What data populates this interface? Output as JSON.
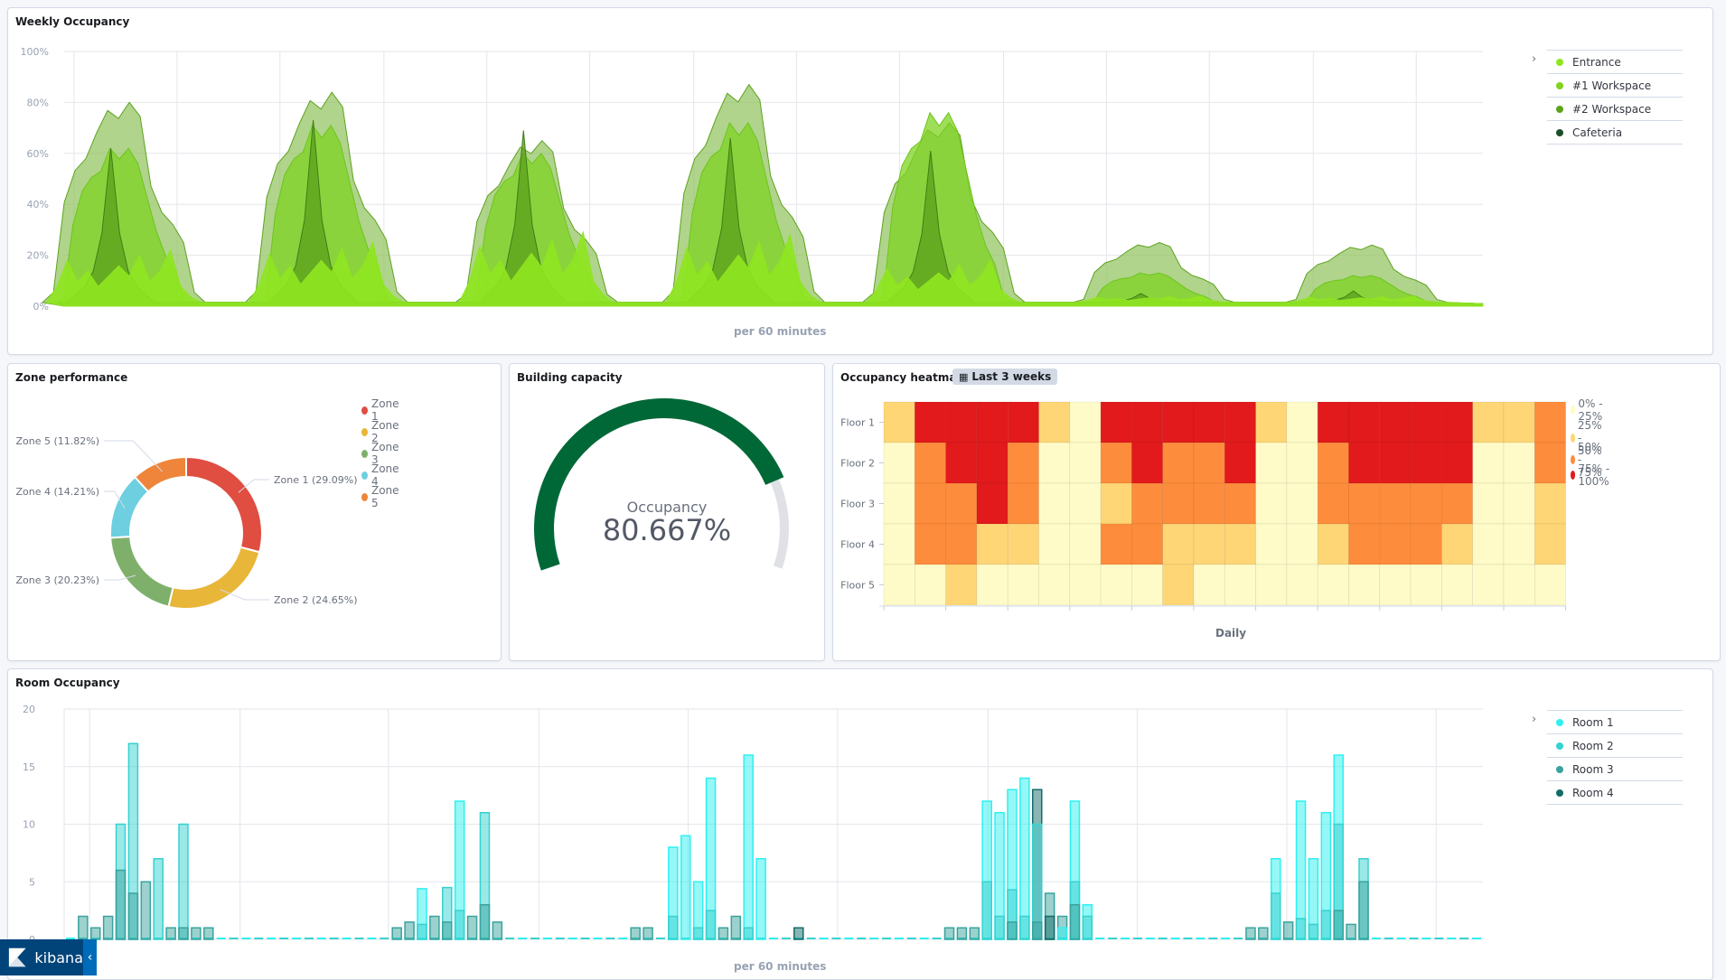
{
  "weekly": {
    "title": "Weekly Occupancy",
    "x_label": "per 60 minutes",
    "y_ticks": [
      "0%",
      "20%",
      "40%",
      "60%",
      "80%",
      "100%"
    ],
    "legend": [
      {
        "label": "Entrance",
        "color": "#8fe520"
      },
      {
        "label": "#1 Workspace",
        "color": "#7fd321"
      },
      {
        "label": "#2 Workspace",
        "color": "#5da31d"
      },
      {
        "label": "Cafeteria",
        "color": "#1e4d2b"
      }
    ]
  },
  "zone": {
    "title": "Zone performance",
    "legend": [
      {
        "label": "Zone 1",
        "color": "#e04d41"
      },
      {
        "label": "Zone 2",
        "color": "#e8b638"
      },
      {
        "label": "Zone 3",
        "color": "#7eb06c"
      },
      {
        "label": "Zone 4",
        "color": "#6dcfe0"
      },
      {
        "label": "Zone 5",
        "color": "#ee853b"
      }
    ]
  },
  "capacity": {
    "title": "Building capacity",
    "label": "Occupancy",
    "value_text": "80.667%",
    "value": 80.667,
    "color": "#006837",
    "track_color": "#e0e1e6"
  },
  "heatmap": {
    "title": "Occupancy heatmap",
    "time_badge": "Last 3 weeks",
    "x_label": "Daily"
  },
  "rooms": {
    "title": "Room Occupancy",
    "x_label": "per 60 minutes",
    "y_ticks": [
      "0",
      "5",
      "10",
      "15",
      "20"
    ],
    "legend": [
      {
        "label": "Room 1",
        "color": "#2ef0f0"
      },
      {
        "label": "Room 2",
        "color": "#36d2d0"
      },
      {
        "label": "Room 3",
        "color": "#3aa39e"
      },
      {
        "label": "Room 4",
        "color": "#146b69"
      }
    ]
  },
  "brand": {
    "name": "kibana",
    "collapse_icon": "‹"
  },
  "chart_data": [
    {
      "type": "area",
      "title": "Weekly Occupancy",
      "xlabel": "per 60 minutes",
      "ylabel": "",
      "ylim": [
        0,
        100
      ],
      "grid": true,
      "legend": "right",
      "y_unit": "%",
      "days": 7,
      "series": [
        {
          "name": "#2 Workspace",
          "day_peaks": [
            80,
            84,
            65,
            87,
            72,
            25,
            24
          ]
        },
        {
          "name": "#1 Workspace",
          "day_peaks": [
            62,
            71,
            60,
            72,
            76,
            13,
            12
          ]
        },
        {
          "name": "Cafeteria",
          "day_peaks": [
            62,
            73,
            69,
            66,
            61,
            5,
            6
          ]
        },
        {
          "name": "Entrance",
          "day_peaks": [
            22,
            25,
            29,
            28,
            18,
            4,
            4
          ]
        }
      ]
    },
    {
      "type": "pie",
      "title": "Zone performance",
      "donut": true,
      "categories": [
        "Zone 1",
        "Zone 2",
        "Zone 3",
        "Zone 4",
        "Zone 5"
      ],
      "values": [
        29.09,
        24.65,
        20.23,
        14.21,
        11.82
      ],
      "labels": [
        "Zone 1 (29.09%)",
        "Zone 2 (24.65%)",
        "Zone 3 (20.23%)",
        "Zone 4 (14.21%)",
        "Zone 5 (11.82%)"
      ],
      "legend": "top-right"
    },
    {
      "type": "heatmap",
      "title": "Occupancy heatmap",
      "xlabel": "Daily",
      "rows": [
        "Floor 1",
        "Floor 2",
        "Floor 3",
        "Floor 4",
        "Floor 5"
      ],
      "num_columns": 22,
      "bands": [
        {
          "label": "0% - 25%",
          "color": "#fefbc8"
        },
        {
          "label": "25% - 50%",
          "color": "#fed676"
        },
        {
          "label": "50% - 75%",
          "color": "#fd8c3c"
        },
        {
          "label": "75% - 100%",
          "color": "#e21a1c"
        }
      ],
      "band_index_matrix": [
        [
          2,
          4,
          4,
          4,
          4,
          2,
          1,
          4,
          4,
          4,
          4,
          4,
          2,
          1,
          4,
          4,
          4,
          4,
          4,
          2,
          2,
          3
        ],
        [
          1,
          3,
          4,
          4,
          3,
          1,
          1,
          3,
          4,
          3,
          3,
          4,
          1,
          1,
          3,
          4,
          4,
          4,
          4,
          1,
          1,
          3
        ],
        [
          1,
          3,
          3,
          4,
          3,
          1,
          1,
          2,
          3,
          3,
          3,
          3,
          1,
          1,
          3,
          3,
          3,
          3,
          3,
          1,
          1,
          2
        ],
        [
          1,
          3,
          3,
          2,
          2,
          1,
          1,
          3,
          3,
          2,
          2,
          2,
          1,
          1,
          2,
          3,
          3,
          3,
          2,
          1,
          1,
          2
        ],
        [
          1,
          1,
          2,
          1,
          1,
          1,
          1,
          1,
          1,
          2,
          1,
          1,
          1,
          1,
          1,
          1,
          1,
          1,
          1,
          1,
          1,
          1
        ]
      ],
      "legend": "right"
    },
    {
      "type": "bar",
      "title": "Room Occupancy",
      "xlabel": "per 60 minutes",
      "ylim": [
        0,
        20
      ],
      "grid": true,
      "legend": "right",
      "stacked": false,
      "bins": 113,
      "bars": [
        {
          "bin": 1,
          "values": [
            0,
            0,
            2,
            0
          ]
        },
        {
          "bin": 2,
          "values": [
            0,
            0,
            1,
            0
          ]
        },
        {
          "bin": 3,
          "values": [
            0,
            0,
            2,
            0
          ]
        },
        {
          "bin": 4,
          "values": [
            0,
            10,
            6,
            0
          ]
        },
        {
          "bin": 5,
          "values": [
            0,
            17,
            4,
            0
          ]
        },
        {
          "bin": 6,
          "values": [
            0,
            0,
            5,
            0
          ]
        },
        {
          "bin": 7,
          "values": [
            0,
            7,
            0,
            0
          ]
        },
        {
          "bin": 8,
          "values": [
            0,
            0,
            1,
            0
          ]
        },
        {
          "bin": 9,
          "values": [
            0,
            10,
            1,
            0
          ]
        },
        {
          "bin": 10,
          "values": [
            0,
            0,
            1,
            0
          ]
        },
        {
          "bin": 11,
          "values": [
            0,
            0,
            1,
            0
          ]
        },
        {
          "bin": 26,
          "values": [
            0,
            0,
            1,
            0
          ]
        },
        {
          "bin": 27,
          "values": [
            0,
            0,
            1.5,
            0
          ]
        },
        {
          "bin": 28,
          "values": [
            4.4,
            1.3,
            0,
            0
          ]
        },
        {
          "bin": 29,
          "values": [
            0,
            0,
            2,
            0
          ]
        },
        {
          "bin": 30,
          "values": [
            0,
            4.5,
            1.5,
            0
          ]
        },
        {
          "bin": 31,
          "values": [
            12,
            2.5,
            0,
            0
          ]
        },
        {
          "bin": 32,
          "values": [
            0,
            0,
            2,
            0
          ]
        },
        {
          "bin": 33,
          "values": [
            0,
            11,
            3,
            0
          ]
        },
        {
          "bin": 34,
          "values": [
            0,
            0,
            1.5,
            0
          ]
        },
        {
          "bin": 45,
          "values": [
            0,
            0,
            1,
            0
          ]
        },
        {
          "bin": 46,
          "values": [
            0,
            0,
            1,
            0
          ]
        },
        {
          "bin": 48,
          "values": [
            8,
            2,
            0,
            0
          ]
        },
        {
          "bin": 49,
          "values": [
            9,
            0,
            0,
            0
          ]
        },
        {
          "bin": 50,
          "values": [
            5,
            1,
            0,
            0
          ]
        },
        {
          "bin": 51,
          "values": [
            14,
            2.5,
            0,
            0
          ]
        },
        {
          "bin": 52,
          "values": [
            0,
            0,
            1,
            0
          ]
        },
        {
          "bin": 53,
          "values": [
            0,
            0,
            2,
            0
          ]
        },
        {
          "bin": 54,
          "values": [
            16,
            1,
            0,
            0
          ]
        },
        {
          "bin": 55,
          "values": [
            7,
            0,
            0,
            0
          ]
        },
        {
          "bin": 58,
          "values": [
            0,
            0,
            0,
            1
          ]
        },
        {
          "bin": 70,
          "values": [
            0,
            0,
            1,
            0
          ]
        },
        {
          "bin": 71,
          "values": [
            0,
            0,
            1,
            0
          ]
        },
        {
          "bin": 72,
          "values": [
            0,
            0,
            1,
            0
          ]
        },
        {
          "bin": 73,
          "values": [
            12,
            5,
            0,
            0
          ]
        },
        {
          "bin": 74,
          "values": [
            11,
            2,
            0,
            0
          ]
        },
        {
          "bin": 75,
          "values": [
            13,
            4.3,
            1.5,
            0
          ]
        },
        {
          "bin": 76,
          "values": [
            14,
            2,
            0,
            0
          ]
        },
        {
          "bin": 77,
          "values": [
            0,
            10,
            1.5,
            13
          ]
        },
        {
          "bin": 78,
          "values": [
            0,
            0,
            4,
            2
          ]
        },
        {
          "bin": 79,
          "values": [
            1,
            0,
            2,
            0
          ]
        },
        {
          "bin": 80,
          "values": [
            12,
            5,
            3,
            0
          ]
        },
        {
          "bin": 81,
          "values": [
            3,
            2,
            0,
            0
          ]
        },
        {
          "bin": 94,
          "values": [
            0,
            0,
            1,
            0
          ]
        },
        {
          "bin": 95,
          "values": [
            0,
            0,
            1,
            0
          ]
        },
        {
          "bin": 96,
          "values": [
            7,
            4,
            0,
            0
          ]
        },
        {
          "bin": 97,
          "values": [
            0,
            0,
            1.5,
            0
          ]
        },
        {
          "bin": 98,
          "values": [
            12,
            1.8,
            0,
            0
          ]
        },
        {
          "bin": 99,
          "values": [
            7,
            1.3,
            0,
            0
          ]
        },
        {
          "bin": 100,
          "values": [
            11,
            2.5,
            0,
            0
          ]
        },
        {
          "bin": 101,
          "values": [
            16,
            10,
            2.5,
            0
          ]
        },
        {
          "bin": 102,
          "values": [
            0,
            0,
            1.3,
            0
          ]
        },
        {
          "bin": 103,
          "values": [
            0,
            7,
            5,
            0
          ]
        }
      ]
    }
  ]
}
